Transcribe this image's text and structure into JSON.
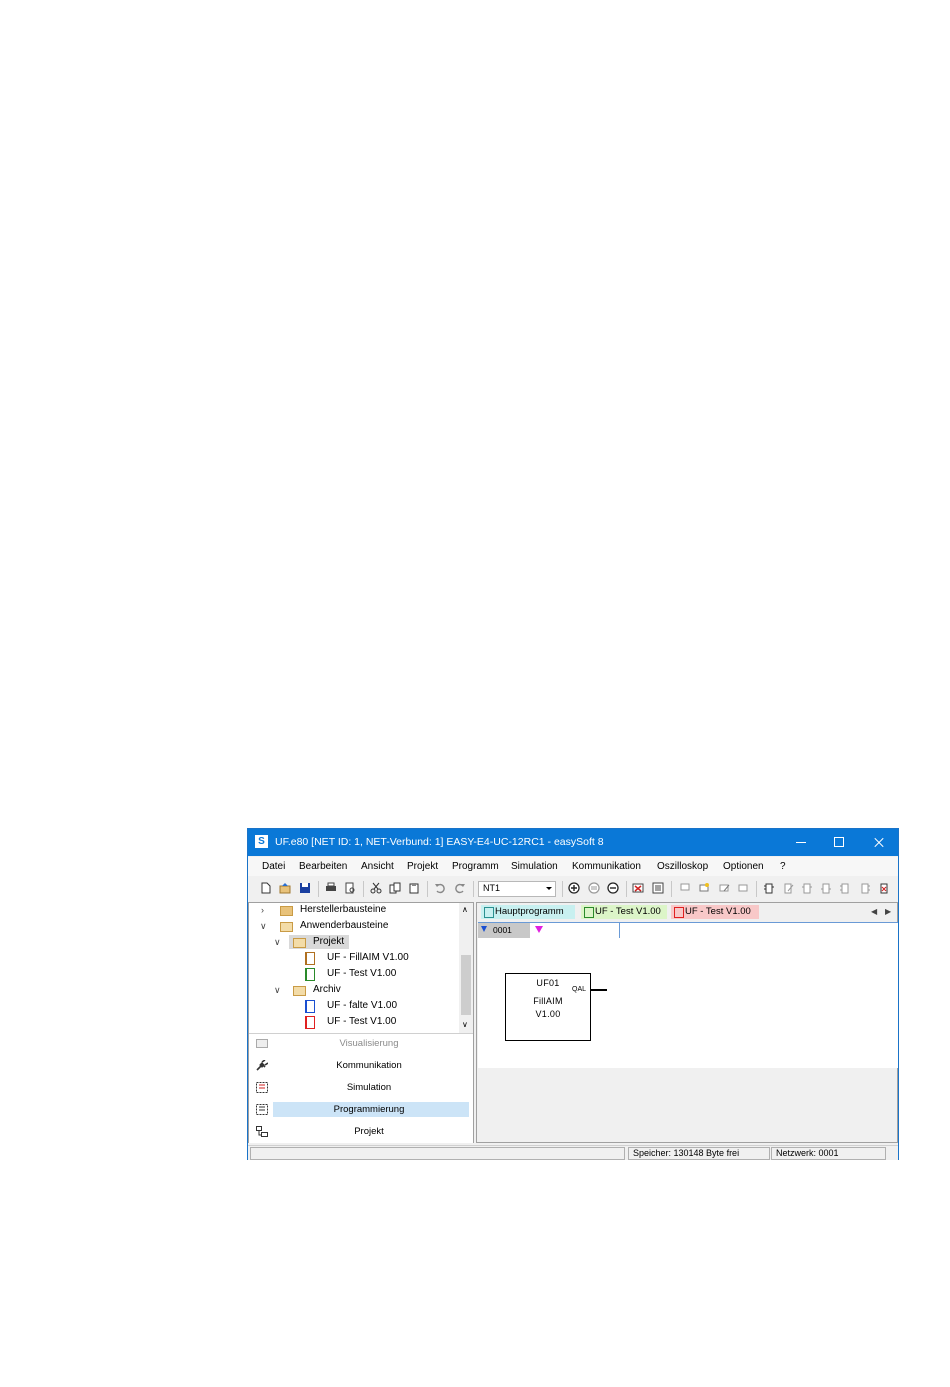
{
  "window": {
    "title": "UF.e80 [NET ID: 1, NET-Verbund: 1] EASY-E4-UC-12RC1 - easySoft 8",
    "app_icon": "S",
    "controls": [
      "minimize-icon",
      "maximize-icon",
      "close-icon"
    ]
  },
  "menu": [
    "Datei",
    "Bearbeiten",
    "Ansicht",
    "Projekt",
    "Programm",
    "Simulation",
    "Kommunikation",
    "Oszilloskop",
    "Optionen",
    "?"
  ],
  "toolbar": {
    "network_select": "NT1",
    "icons": [
      "new-icon",
      "open-icon",
      "save-icon",
      "print-icon",
      "print-preview-icon",
      "cut-icon",
      "copy-icon",
      "paste-icon",
      "undo-icon",
      "redo-icon",
      "zoom-in-icon",
      "zoom-reset-icon",
      "zoom-out-icon",
      "delete-network-icon",
      "properties-icon",
      "comment-icon",
      "add-comment-icon",
      "edit-comment-icon",
      "remove-comment-icon",
      "insert-block-icon",
      "edit-block-icon",
      "block-a-icon",
      "block-b-icon",
      "block-c-icon",
      "block-d-icon",
      "block-e-icon"
    ]
  },
  "tree": {
    "items": [
      {
        "label": "Herstellerbausteine",
        "level": 0,
        "expanded": false,
        "icon": "folder-icon"
      },
      {
        "label": "Anwenderbausteine",
        "level": 0,
        "expanded": true,
        "icon": "folder-open-icon"
      },
      {
        "label": "Projekt",
        "level": 1,
        "expanded": true,
        "icon": "folder-open-icon",
        "selected": true
      },
      {
        "label": "UF - FillAIM V1.00",
        "level": 2,
        "icon": "uf-block-icon",
        "color": "#b07020"
      },
      {
        "label": "UF - Test V1.00",
        "level": 2,
        "icon": "uf-block-icon",
        "color": "#2a8a2a"
      },
      {
        "label": "Archiv",
        "level": 1,
        "expanded": true,
        "icon": "folder-open-icon"
      },
      {
        "label": "UF - falte V1.00",
        "level": 2,
        "icon": "uf-block-icon",
        "color": "#1a4fd0"
      },
      {
        "label": "UF - Test V1.00",
        "level": 2,
        "icon": "uf-block-icon",
        "color": "#e02020"
      }
    ]
  },
  "nav": [
    {
      "label": "Visualisierung",
      "icon": "visualization-icon",
      "disabled": true
    },
    {
      "label": "Kommunikation",
      "icon": "plug-icon"
    },
    {
      "label": "Simulation",
      "icon": "simulation-icon"
    },
    {
      "label": "Programmierung",
      "icon": "programming-icon",
      "active": true
    },
    {
      "label": "Projekt",
      "icon": "project-tree-icon"
    }
  ],
  "tabs": [
    {
      "label": "Hauptprogramm",
      "bg": "#c8f0f0",
      "icon_color": "#2a9090"
    },
    {
      "label": "UF - Test V1.00",
      "bg": "#dcf5c8",
      "icon_color": "#2a8a2a"
    },
    {
      "label": "UF - Test V1.00",
      "bg": "#f8c8c8",
      "icon_color": "#e02020"
    }
  ],
  "network": {
    "number": "0001"
  },
  "function_block": {
    "line1": "UF01",
    "line2": "FillAIM",
    "line3": "V1.00",
    "output_pin": "QAL"
  },
  "status": {
    "memory": "Speicher: 130148 Byte frei",
    "network": "Netzwerk: 0001"
  }
}
